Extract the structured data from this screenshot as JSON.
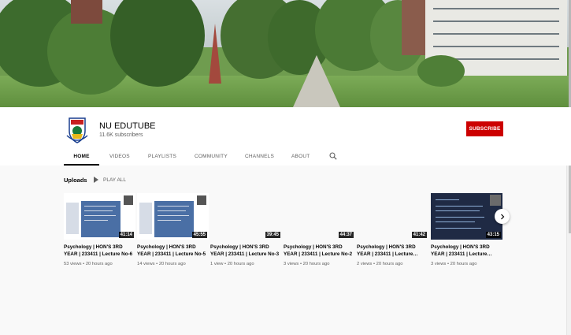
{
  "channel": {
    "name": "NU EDUTUBE",
    "subscribers": "11.6K subscribers",
    "subscribe_label": "SUBSCRIBE"
  },
  "tabs": [
    {
      "label": "HOME",
      "active": true
    },
    {
      "label": "VIDEOS",
      "active": false
    },
    {
      "label": "PLAYLISTS",
      "active": false
    },
    {
      "label": "COMMUNITY",
      "active": false
    },
    {
      "label": "CHANNELS",
      "active": false
    },
    {
      "label": "ABOUT",
      "active": false
    }
  ],
  "search_icon": "search-icon",
  "uploads": {
    "title": "Uploads",
    "play_all": "PLAY ALL",
    "videos": [
      {
        "title": "Psychology | HON'S 3RD YEAR | 233411 | Lecture No-6",
        "duration": "41:14",
        "views": "53 views",
        "age": "20 hours ago",
        "thumb": "slide"
      },
      {
        "title": "Psychology | HON'S 3RD YEAR | 233411 | Lecture No-5",
        "duration": "45:55",
        "views": "14 views",
        "age": "20 hours ago",
        "thumb": "slide"
      },
      {
        "title": "Psychology | HON'S 3RD YEAR | 233411 | Lecture No-3",
        "duration": "39:45",
        "views": "1 view",
        "age": "20 hours ago",
        "thumb": "blank"
      },
      {
        "title": "Psychology | HON'S 3RD YEAR | 233411 | Lecture No-2",
        "duration": "44:37",
        "views": "3 views",
        "age": "20 hours ago",
        "thumb": "blank"
      },
      {
        "title": "Psychology | HON'S 3RD YEAR | 233411 | Lecture…",
        "duration": "41:42",
        "views": "2 views",
        "age": "20 hours ago",
        "thumb": "blank"
      },
      {
        "title": "Psychology | HON'S 3RD YEAR | 233411 | Lecture…",
        "duration": "43:15",
        "views": "3 views",
        "age": "20 hours ago",
        "thumb": "dark"
      }
    ]
  },
  "next_icon": "chevron-right-icon",
  "colors": {
    "subscribe": "#cc0000",
    "text_primary": "#030303",
    "text_secondary": "#606060"
  }
}
